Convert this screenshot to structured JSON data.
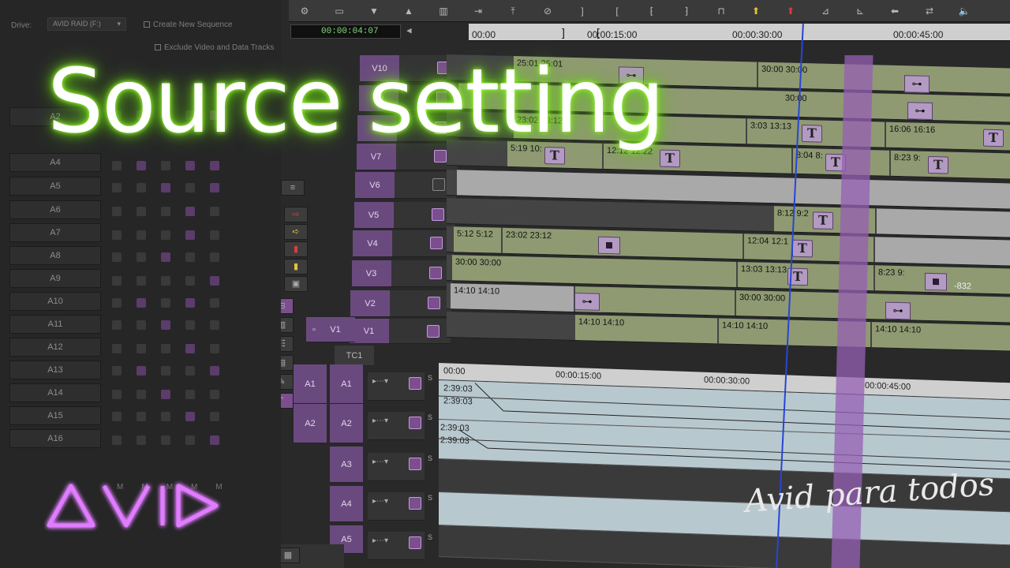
{
  "source_panel": {
    "drive_label": "Drive:",
    "drive_value": "AVID RAID (F:)",
    "create_sequence_label": "Create New Sequence",
    "exclude_tracks_label": "Exclude Video and Data Tracks",
    "audio_tracks": [
      "A2",
      "A4",
      "A5",
      "A6",
      "A7",
      "A8",
      "A9",
      "A10",
      "A11",
      "A12",
      "A13",
      "A14",
      "A15",
      "A16"
    ],
    "solo_labels": [
      "M",
      "M",
      "M",
      "M",
      "M"
    ]
  },
  "toolbar": {
    "icons": [
      "settings-icon",
      "panel-icon",
      "down-arrow-icon",
      "up-arrow-icon",
      "sequence-icon",
      "export-icon",
      "lift-icon",
      "no-icon",
      "mark-out-icon",
      "mark-in-icon",
      "trim-icon",
      "trim-both-icon",
      "extract-icon",
      "lift-up-icon",
      "overwrite-icon",
      "segment-lift-icon",
      "segment-extract-icon",
      "add-edit-icon",
      "match-frame-icon",
      "speaker-icon"
    ]
  },
  "timecode": "00:00:04:07",
  "ruler": {
    "labels": [
      "00:00",
      "00:00:15:00",
      "00:00:30:00",
      "00:00:45:00"
    ]
  },
  "tracks": {
    "video": [
      "V10",
      "V9",
      "V8",
      "V7",
      "V6",
      "V5",
      "V4",
      "V3",
      "V2",
      "V1"
    ],
    "source_v1": "V1",
    "timecode_track": "TC1",
    "audio_source": [
      "A1",
      "A2"
    ],
    "audio_record": [
      "A1",
      "A2",
      "A3",
      "A4",
      "A5"
    ],
    "solo_label": "S"
  },
  "clips": {
    "v10": [
      "25:01 25:01",
      "30:00 30:00"
    ],
    "v9": [
      "30:00"
    ],
    "v8": [
      "23:02 23:12",
      "3:03 13:13",
      "16:06 16:16"
    ],
    "v7": [
      "5:19 10:",
      "12:12 12:22",
      "8:04 8:",
      "8:23 9:"
    ],
    "v5": [
      "8:12 9:2"
    ],
    "v4": [
      "5:12 5:12",
      "23:02 23:12",
      "12:04 12:1"
    ],
    "v3": [
      "30:00 30:00",
      "13:03 13:13",
      "8:23 9:"
    ],
    "v2": [
      "14:10 14:10",
      "30:00 30:00"
    ],
    "v1": [
      "14:10 14:10",
      "14:10 14:10",
      "14:10 14:10"
    ],
    "v3_number": "-832"
  },
  "audio": {
    "ruler_labels": [
      "00:00",
      "00:00:15:00",
      "00:00:30:00",
      "00:00:45:00"
    ],
    "a1_labels": [
      "2:39:03",
      "2:39:03"
    ],
    "a2_labels": [
      "2:39:03",
      "2:39:03"
    ]
  },
  "overlay": {
    "title": "Source setting",
    "watermark": "Avid para todos"
  },
  "colors": {
    "accent_purple": "#7b4f8e",
    "clip_green": "#8f9a72",
    "glow_green": "#6ddc18",
    "playhead_blue": "#2845d6"
  }
}
